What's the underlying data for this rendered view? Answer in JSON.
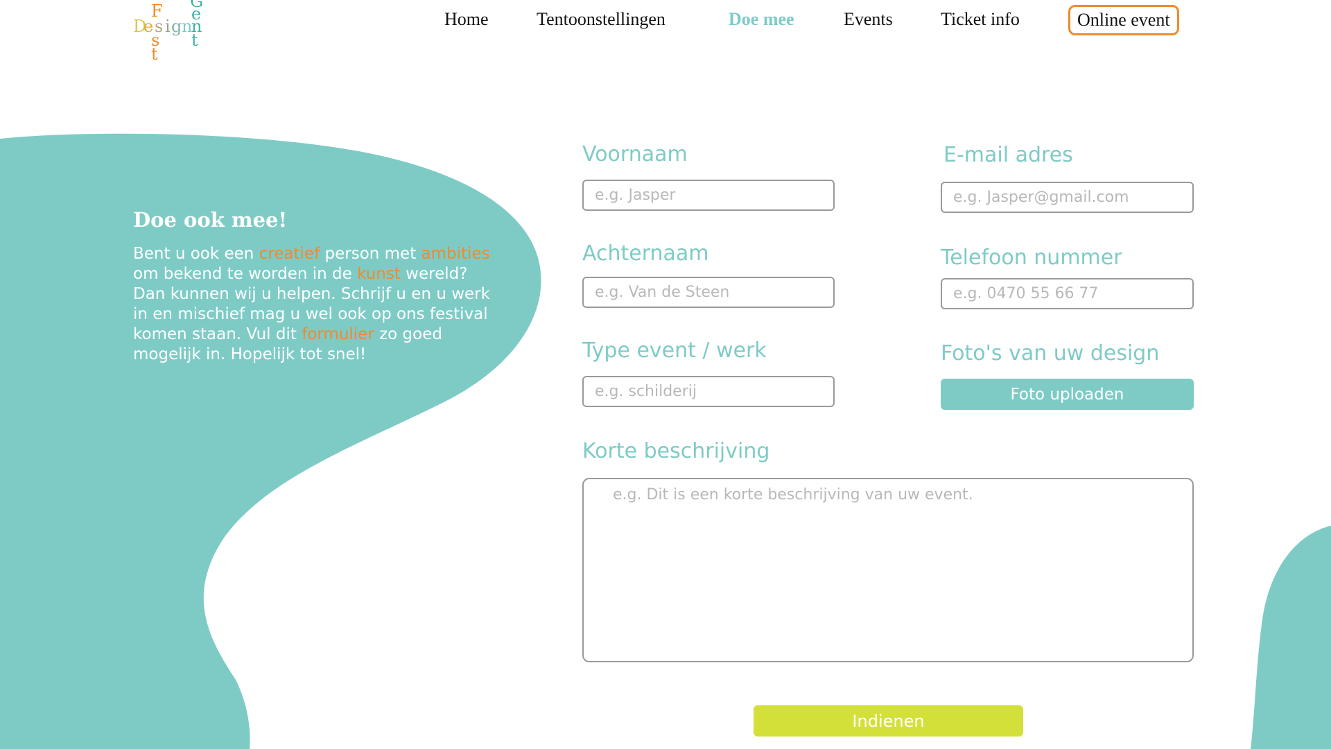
{
  "logo": {
    "letters": {
      "F": "F",
      "D": "D",
      "e": "e",
      "s1": "s",
      "i": "i",
      "g": "g",
      "n": "n",
      "s2": "s",
      "t1": "t",
      "G": "G",
      "e2": "e",
      "n2": "n",
      "t2": "t"
    }
  },
  "nav": {
    "items": [
      {
        "label": "Home"
      },
      {
        "label": "Tentoonstellingen"
      },
      {
        "label": "Doe mee"
      },
      {
        "label": "Events"
      },
      {
        "label": "Ticket info"
      },
      {
        "label": "Online event"
      }
    ]
  },
  "intro": {
    "title": "Doe ook mee!",
    "text_parts": [
      "Bent u ook een ",
      "creatief",
      " person met ",
      "ambities",
      " om bekend te worden in de ",
      "kunst",
      " wereld? Dan kunnen wij u helpen. Schrijf u en u werk in en mischief mag u wel ook op ons festival komen staan. Vul dit ",
      "formulier",
      " zo goed mogelijk in. Hopelijk tot snel!"
    ]
  },
  "form": {
    "first_name": {
      "label": "Voornaam",
      "placeholder": "e.g. Jasper"
    },
    "email": {
      "label": "E-mail adres",
      "placeholder": "e.g. Jasper@gmail.com"
    },
    "last_name": {
      "label": "Achternaam",
      "placeholder": "e.g. Van de Steen"
    },
    "phone": {
      "label": "Telefoon nummer",
      "placeholder": "e.g. 0470 55 66 77"
    },
    "type": {
      "label": "Type event / werk",
      "placeholder": "e.g. schilderij"
    },
    "photos": {
      "label": "Foto's van uw design",
      "button": "Foto uploaden"
    },
    "description": {
      "label": "Korte beschrijving",
      "placeholder": "e.g. Dit is een korte beschrijving van uw event."
    },
    "submit": "Indienen"
  },
  "colors": {
    "teal": "#7ecbc6",
    "orange": "#f08a2c",
    "lime": "#d4e03a"
  }
}
